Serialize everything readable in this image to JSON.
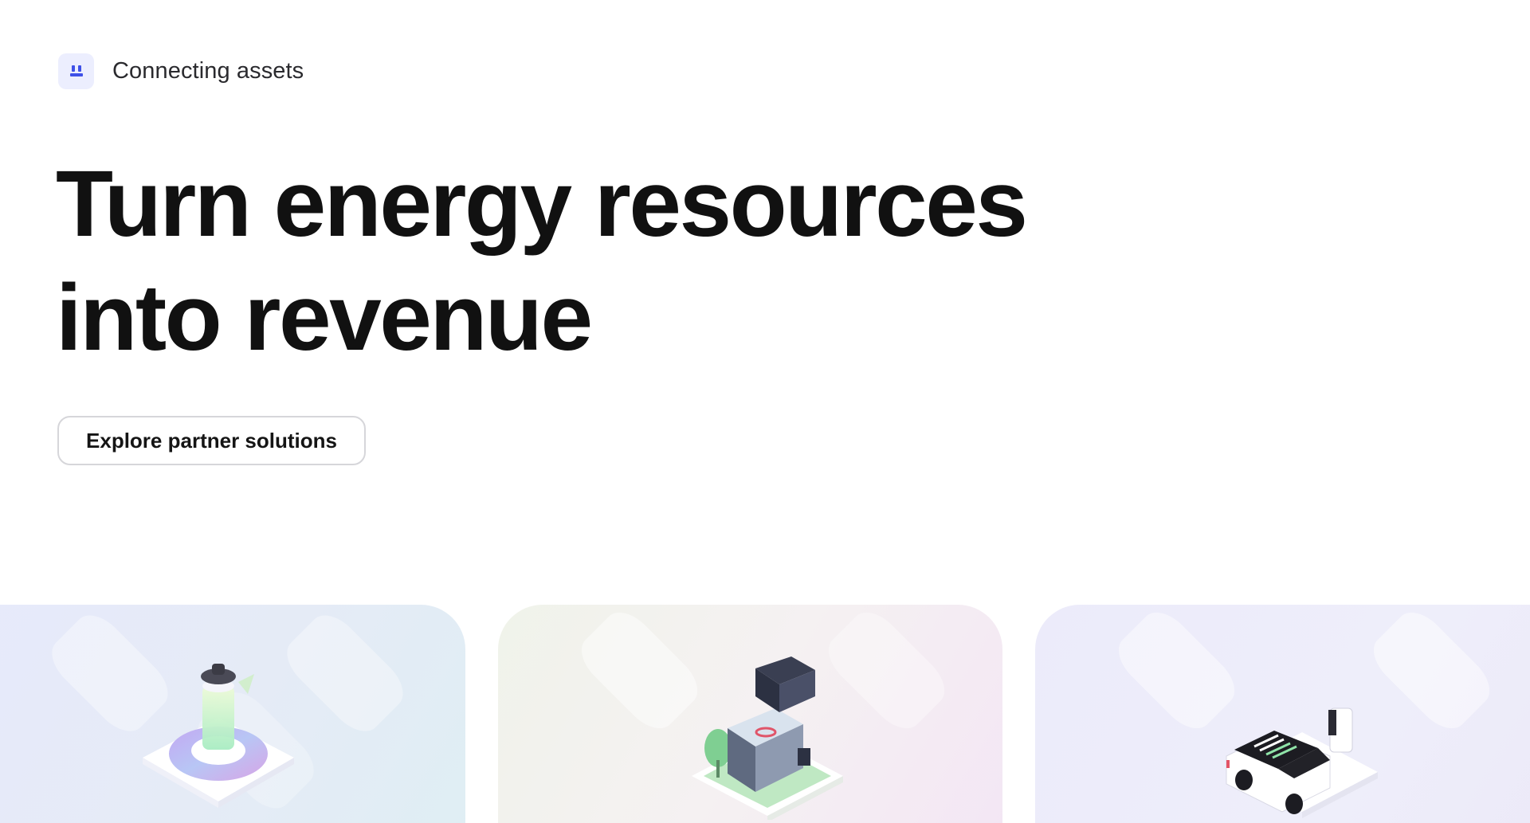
{
  "eyebrow": {
    "icon": "pylon-icon",
    "label": "Connecting assets"
  },
  "hero": {
    "headline_line1": "Turn energy resources",
    "headline_line2": "into revenue"
  },
  "cta": {
    "label": "Explore partner solutions"
  },
  "cards": [
    {
      "icon": "battery-storage-illustration"
    },
    {
      "icon": "smart-home-illustration"
    },
    {
      "icon": "electric-vehicle-charging-illustration"
    }
  ],
  "colors": {
    "text_primary": "#111111",
    "eyebrow_icon_bg": "#eceefe",
    "eyebrow_icon_fg": "#3f51e8",
    "button_border": "#d6d6da"
  }
}
